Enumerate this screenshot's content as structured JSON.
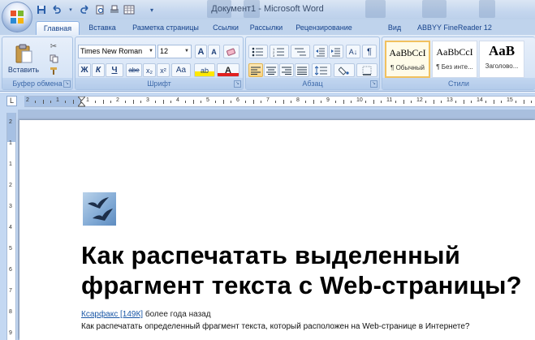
{
  "window": {
    "title": "Документ1 - Microsoft Word"
  },
  "qat": {
    "icons": [
      "save-icon",
      "undo-icon",
      "redo-icon",
      "print-preview-icon",
      "quick-print-icon",
      "customize-icon"
    ]
  },
  "tabs": [
    {
      "label": "Главная"
    },
    {
      "label": "Вставка"
    },
    {
      "label": "Разметка страницы"
    },
    {
      "label": "Ссылки"
    },
    {
      "label": "Рассылки"
    },
    {
      "label": "Рецензирование"
    },
    {
      "label": "Вид"
    },
    {
      "label": "ABBYY FineReader 12"
    }
  ],
  "ribbon": {
    "clipboard": {
      "label": "Буфер обмена",
      "paste_label": "Вставить"
    },
    "font": {
      "label": "Шрифт",
      "font_name": "Times New Roman",
      "font_size": "12",
      "bold": "Ж",
      "italic": "К",
      "underline": "Ч",
      "strike": "abe",
      "subscript": "x₂",
      "superscript": "x²",
      "change_case": "Aa",
      "grow": "A",
      "shrink": "A",
      "font_color": "A",
      "highlight": "ab"
    },
    "paragraph": {
      "label": "Абзац"
    },
    "styles": {
      "label": "Стили",
      "items": [
        {
          "sample": "AaBbCcI",
          "name": "¶ Обычный"
        },
        {
          "sample": "AaBbCcI",
          "name": "¶ Без инте..."
        },
        {
          "sample": "AaB",
          "name": "Заголово..."
        }
      ]
    }
  },
  "ruler": {
    "numbers": [
      "2",
      "1",
      "1",
      "2",
      "3",
      "4",
      "5",
      "6",
      "7",
      "8",
      "9",
      "10",
      "11",
      "12",
      "13",
      "14",
      "15"
    ]
  },
  "vruler": {
    "numbers": [
      "2",
      "1",
      "1",
      "2",
      "3",
      "4",
      "5",
      "6",
      "7",
      "8",
      "9"
    ]
  },
  "document": {
    "headline": "Как распечатать выделенный фрагмент текста с Web-страницы?",
    "author_link": "Ксарфакс [149К]",
    "time_ago": "более года назад",
    "description": "Как распечатать определенный фрагмент текста, который расположен на Web-странице в Интернете?"
  },
  "colors": {
    "accent": "#15428b",
    "ribbon_bg": "#d3e3f6",
    "tab_bar": "#bfd3ec",
    "active_button": "#fbd27d",
    "link": "#1a57a6"
  }
}
